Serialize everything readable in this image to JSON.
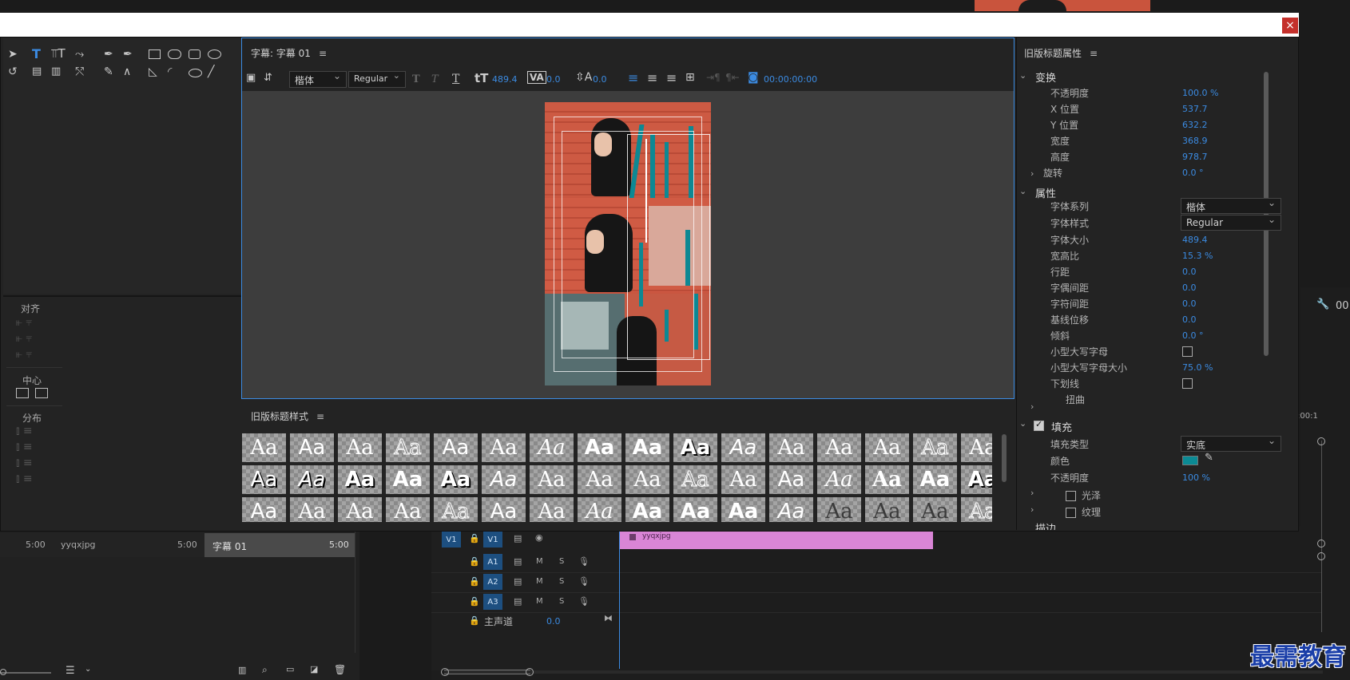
{
  "dialog": {
    "close_glyph": "×"
  },
  "tools": {
    "align_label": "对齐",
    "center_label": "中心",
    "distribute_label": "分布"
  },
  "title_panel": {
    "tab_label": "字幕: 字幕 01",
    "font_family": "楷体",
    "font_style": "Regular",
    "font_size": "489.4",
    "kerning": "0.0",
    "leading": "0.0",
    "timecode": "00:00:00:00"
  },
  "styles_panel": {
    "tab_label": "旧版标题样式",
    "sample": "Aa"
  },
  "properties_panel": {
    "tab_label": "旧版标题属性",
    "sections": {
      "transform": "变换",
      "properties": "属性",
      "fill": "填充",
      "stroke": "描边"
    },
    "transform": [
      {
        "label": "不透明度",
        "value": "100.0 %"
      },
      {
        "label": "X 位置",
        "value": "537.7"
      },
      {
        "label": "Y 位置",
        "value": "632.2"
      },
      {
        "label": "宽度",
        "value": "368.9"
      },
      {
        "label": "高度",
        "value": "978.7"
      },
      {
        "label": "旋转",
        "value": "0.0 °"
      }
    ],
    "props": [
      {
        "label": "字体系列",
        "value": "楷体"
      },
      {
        "label": "字体样式",
        "value": "Regular"
      },
      {
        "label": "字体大小",
        "value": "489.4"
      },
      {
        "label": "宽高比",
        "value": "15.3 %"
      },
      {
        "label": "行距",
        "value": "0.0"
      },
      {
        "label": "字偶间距",
        "value": "0.0"
      },
      {
        "label": "字符间距",
        "value": "0.0"
      },
      {
        "label": "基线位移",
        "value": "0.0"
      },
      {
        "label": "倾斜",
        "value": "0.0 °"
      },
      {
        "label": "小型大写字母",
        "value": ""
      },
      {
        "label": "小型大写字母大小",
        "value": "75.0 %"
      },
      {
        "label": "下划线",
        "value": ""
      },
      {
        "label": "扭曲",
        "value": ""
      }
    ],
    "fill": {
      "type_label": "填充类型",
      "type_value": "实底",
      "color_label": "颜色",
      "color_hex": "#0b8a94",
      "opacity_label": "不透明度",
      "opacity_value": "100 %",
      "sheen_label": "光泽",
      "texture_label": "纹理"
    }
  },
  "project": {
    "row1_dur": "5:00",
    "row1_name": "yyqxjpg",
    "row1_dur2": "5:00",
    "row2_name": "字幕 01",
    "row2_dur": "5:00"
  },
  "timeline": {
    "v1_src": "V1",
    "v1": "V1",
    "a1": "A1",
    "a2": "A2",
    "a3": "A3",
    "m": "M",
    "s": "S",
    "master_label": "主声道",
    "master_value": "0.0",
    "clip_name": "yyqxjpg",
    "ruler_label": ":00:1",
    "counter_right": "00"
  },
  "watermark": {
    "text": "最需教育"
  },
  "colors": {
    "accent": "#3b8be2",
    "clip": "#d985d6",
    "fill_swatch": "#0b8a94"
  }
}
